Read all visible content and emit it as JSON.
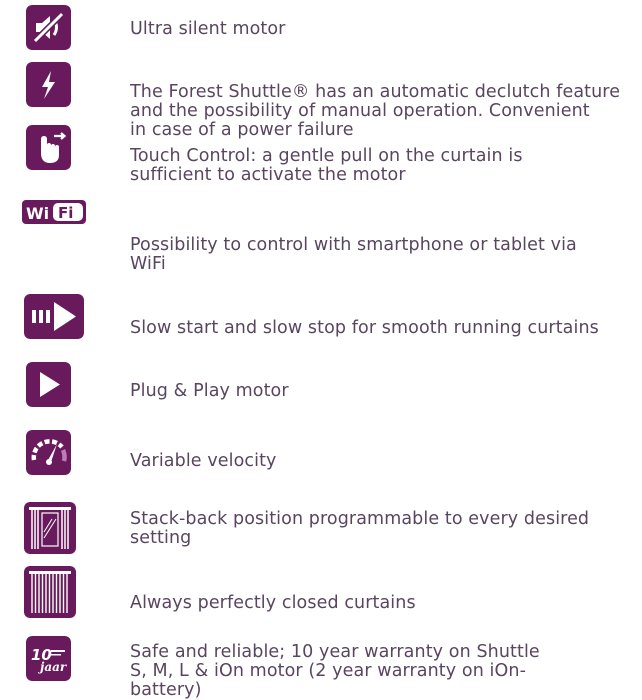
{
  "colors": {
    "icon_bg": "#681a5c",
    "icon_fg": "#ffffff",
    "text": "#5a4560"
  },
  "features": [
    {
      "icon": "mute-speaker-icon",
      "lines": [
        "Ultra silent motor"
      ]
    },
    {
      "icon": "lightning-bolt-icon",
      "lines": [
        "The Forest Shuttle® has an automatic declutch feature",
        "and the possibility of manual operation. Convenient",
        "in case of a power failure"
      ]
    },
    {
      "icon": "touch-hand-icon",
      "lines": [
        "Touch Control: a gentle pull on the curtain is",
        "sufficient to activate the motor"
      ]
    },
    {
      "icon": "wifi-icon",
      "icon_text": "Wi Fi",
      "lines": [
        "Possibility to control with smartphone or tablet via",
        "WiFi"
      ]
    },
    {
      "icon": "slow-start-icon",
      "lines": [
        "Slow start and slow stop for smooth running curtains"
      ]
    },
    {
      "icon": "play-icon",
      "lines": [
        "Plug & Play motor"
      ]
    },
    {
      "icon": "speedometer-icon",
      "lines": [
        "Variable velocity"
      ]
    },
    {
      "icon": "stack-back-curtain-icon",
      "lines": [
        "Stack-back position programmable to every desired",
        "setting"
      ]
    },
    {
      "icon": "closed-curtain-icon",
      "lines": [
        "Always perfectly closed curtains"
      ]
    },
    {
      "icon": "warranty-badge-icon",
      "icon_text": "10 jaar",
      "lines": [
        "Safe and reliable; 10 year warranty on Shuttle",
        "S, M, L & iOn motor (2 year warranty on iOn-",
        "battery)"
      ]
    }
  ]
}
